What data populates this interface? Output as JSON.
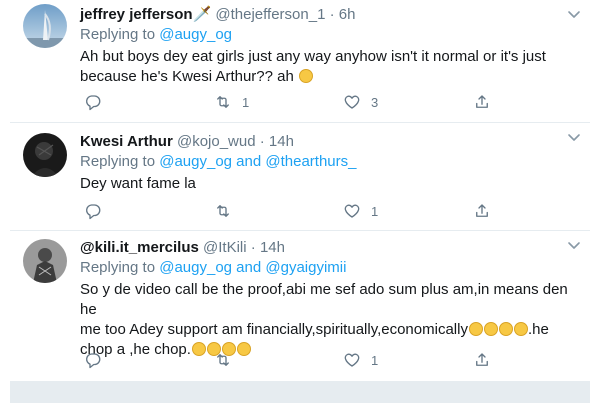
{
  "tweets": [
    {
      "name": "jeffrey jefferson🗡️",
      "handle": "@thejefferson_1",
      "separator": "·",
      "time": "6h",
      "replying_prefix": "Replying to ",
      "replying_to": "@augy_og",
      "text": "Ah but boys dey eat girls just any way anyhow isn't it normal or it's just because he's Kwesi Arthur?? ah",
      "reply_count": "",
      "retweet_count": "1",
      "like_count": "3"
    },
    {
      "name": "Kwesi Arthur",
      "handle": "@kojo_wud",
      "separator": "·",
      "time": "14h",
      "replying_prefix": "Replying to ",
      "replying_to": "@augy_og",
      "replying_and": " and ",
      "replying_to_2": "@thearthurs_",
      "text": "Dey want fame la",
      "reply_count": "",
      "retweet_count": "",
      "like_count": "1"
    },
    {
      "name": "@kili.it_mercilus",
      "handle": "@ItKili",
      "separator": "·",
      "time": "14h",
      "replying_prefix": "Replying to ",
      "replying_to": "@augy_og",
      "replying_and": " and ",
      "replying_to_2": "@gyaigyimii",
      "text_line1": "So y de video call be the proof,abi me sef ado sum plus am,in means den he",
      "text_line2": "me too Adey support am financially,spiritually,economically",
      "text_line2_tail": ".he",
      "text_line3": "chop a ,he chop.",
      "reply_count": "",
      "retweet_count": "",
      "like_count": "1"
    }
  ],
  "icons": {
    "reply": "reply-icon",
    "retweet": "retweet-icon",
    "like": "heart-icon",
    "share": "share-icon",
    "more": "chevron-down-icon"
  },
  "colors": {
    "text": "#14171a",
    "muted": "#657786",
    "link": "#1da1f2",
    "divider": "#e6ecf0"
  }
}
